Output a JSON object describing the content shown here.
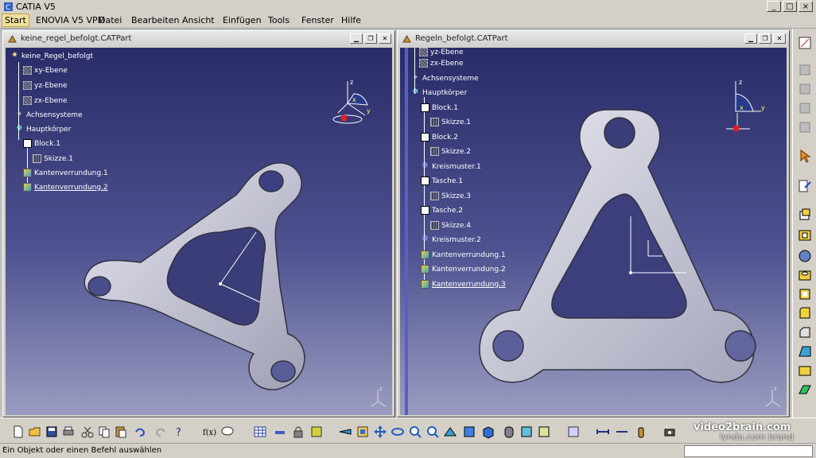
{
  "app": {
    "title": "CATIA V5"
  },
  "menu": [
    "Start",
    "ENOVIA V5 VPM",
    "Datei",
    "Bearbeiten",
    "Ansicht",
    "Einfügen",
    "Tools",
    "Fenster",
    "Hilfe"
  ],
  "left_doc": {
    "title": "keine_regel_befolgt.CATPart",
    "tree": [
      {
        "label": "keine_Regel_befolgt",
        "type": "root"
      },
      {
        "label": "xy-Ebene",
        "type": "plane"
      },
      {
        "label": "yz-Ebene",
        "type": "plane"
      },
      {
        "label": "zx-Ebene",
        "type": "plane"
      },
      {
        "label": "Achsensysteme",
        "type": "axis"
      },
      {
        "label": "Hauptkörper",
        "type": "body"
      },
      {
        "label": "Block.1",
        "type": "pad"
      },
      {
        "label": "Skizze.1",
        "type": "sketch"
      },
      {
        "label": "Kantenverrundung.1",
        "type": "fillet"
      },
      {
        "label": "Kantenverrundung.2",
        "type": "fillet"
      }
    ]
  },
  "right_doc": {
    "title": "Regeln_befolgt.CATPart",
    "tree": [
      {
        "label": "yz-Ebene",
        "type": "plane"
      },
      {
        "label": "zx-Ebene",
        "type": "plane"
      },
      {
        "label": "Achsensysteme",
        "type": "axis"
      },
      {
        "label": "Hauptkörper",
        "type": "body"
      },
      {
        "label": "Block.1",
        "type": "pad"
      },
      {
        "label": "Skizze.1",
        "type": "sketch"
      },
      {
        "label": "Block.2",
        "type": "pad"
      },
      {
        "label": "Skizze.2",
        "type": "sketch"
      },
      {
        "label": "Kreismuster.1",
        "type": "pattern"
      },
      {
        "label": "Tasche.1",
        "type": "pocket"
      },
      {
        "label": "Skizze.3",
        "type": "sketch"
      },
      {
        "label": "Tasche.2",
        "type": "pocket"
      },
      {
        "label": "Skizze.4",
        "type": "sketch"
      },
      {
        "label": "Kreismuster.2",
        "type": "pattern"
      },
      {
        "label": "Kantenverrundung.1",
        "type": "fillet"
      },
      {
        "label": "Kantenverrundung.2",
        "type": "fillet"
      },
      {
        "label": "Kantenverrundung.3",
        "type": "fillet"
      }
    ]
  },
  "compass": {
    "x": "x",
    "y": "y",
    "z": "z"
  },
  "status": {
    "text": "Ein Objekt oder einen Befehl auswählen"
  },
  "watermark": {
    "brand": "video2brain.com",
    "sub": "lynda.com brand"
  },
  "colors": {
    "viewport_top": "#2a2c68",
    "viewport_bottom": "#9a9cc0",
    "part": "#c8c8d4"
  }
}
